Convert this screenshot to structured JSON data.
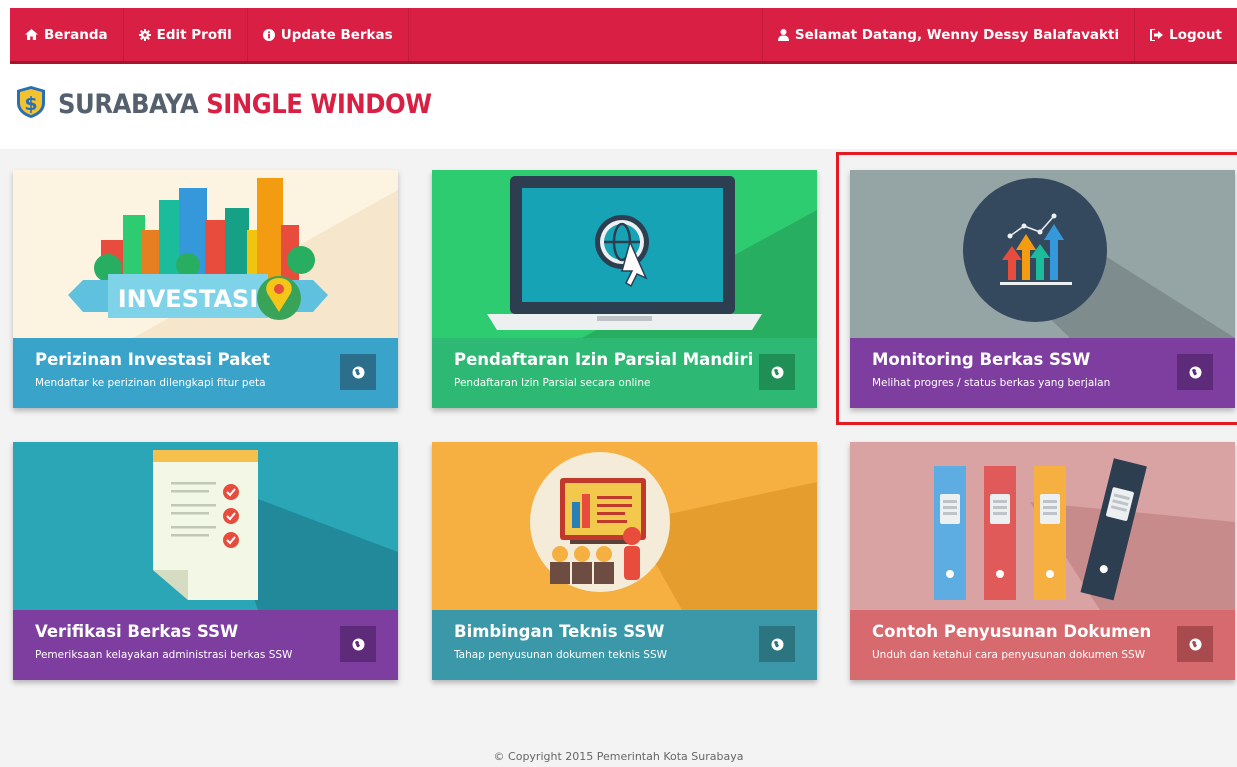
{
  "nav": {
    "home": "Beranda",
    "edit_profile": "Edit Profil",
    "update_files": "Update Berkas",
    "welcome": "Selamat Datang, Wenny Dessy Balafavakti",
    "logout": "Logout"
  },
  "brand": {
    "part1": "SURABAYA",
    "part2": "SINGLE WINDOW"
  },
  "cards": [
    {
      "title": "Perizinan Investasi Paket",
      "subtitle": "Mendaftar ke perizinan dilengkapi fitur peta",
      "art_label": "INVESTASI",
      "art_icon": "city-investasi-icon",
      "action_icon": "globe-icon"
    },
    {
      "title": "Pendaftaran Izin Parsial Mandiri",
      "subtitle": "Pendaftaran Izin Parsial secara online",
      "art_icon": "laptop-globe-icon",
      "action_icon": "globe-icon"
    },
    {
      "title": "Monitoring Berkas SSW",
      "subtitle": "Melihat progres / status berkas yang berjalan",
      "art_icon": "chart-arrows-icon",
      "action_icon": "globe-icon"
    },
    {
      "title": "Verifikasi Berkas SSW",
      "subtitle": "Pemeriksaan kelayakan administrasi berkas SSW",
      "art_icon": "checklist-icon",
      "action_icon": "globe-icon"
    },
    {
      "title": "Bimbingan Teknis SSW",
      "subtitle": "Tahap penyusunan dokumen teknis SSW",
      "art_icon": "presentation-icon",
      "action_icon": "globe-icon"
    },
    {
      "title": "Contoh Penyusunan Dokumen",
      "subtitle": "Unduh dan ketahui cara penyusunan dokumen SSW",
      "art_icon": "binders-icon",
      "action_icon": "globe-icon"
    }
  ],
  "colors": {
    "navbar": "#d91f43",
    "card_blue": "#3aa3c9",
    "card_green": "#2db873",
    "card_purple": "#7e3ea0",
    "card_teal": "#3b98a8",
    "card_rose": "#d66a6e",
    "highlight": "#e41b23"
  },
  "footer": "© Copyright 2015 Pemerintah Kota Surabaya"
}
